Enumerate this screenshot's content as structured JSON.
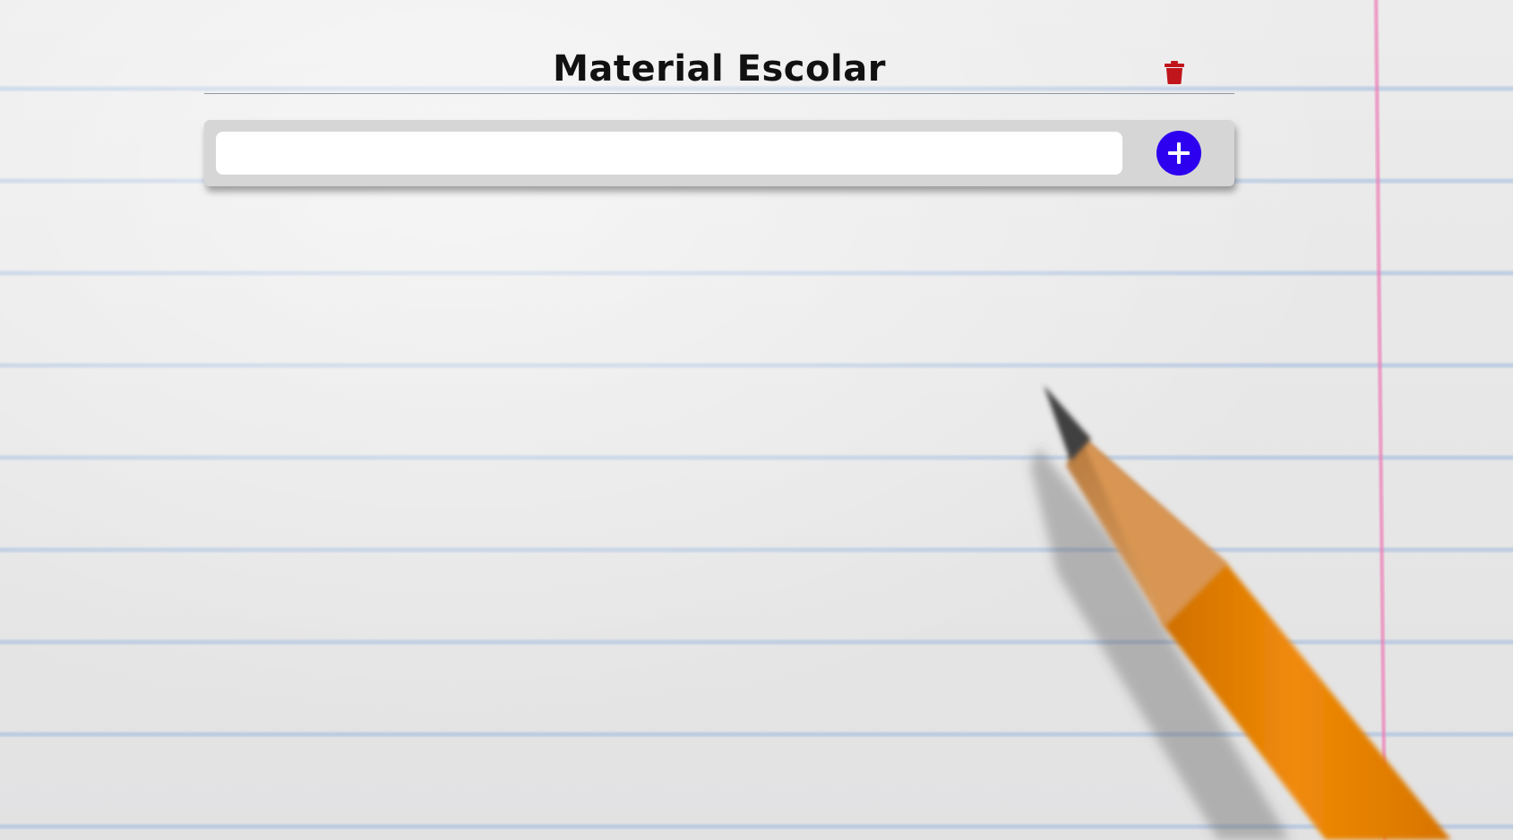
{
  "header": {
    "title": "Material Escolar"
  },
  "toolbar": {
    "clear_icon": "trash-icon",
    "clear_icon_color": "#c0151b"
  },
  "new_item": {
    "value": "",
    "placeholder": "",
    "add_icon": "plus-icon",
    "add_button_color": "#2e00f0"
  },
  "items": []
}
